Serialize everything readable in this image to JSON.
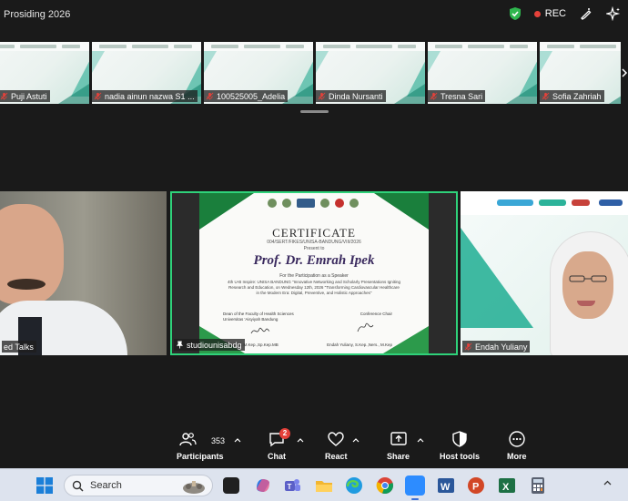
{
  "window": {
    "title": "Prosiding 2026",
    "rec_label": "REC",
    "colors": {
      "rec": "#e5413a",
      "shield": "#2fb64e",
      "active_speaker": "#2fd27a"
    }
  },
  "filmstrip": {
    "tiles": [
      {
        "name": "Puji Astuti"
      },
      {
        "name": "nadia ainun nazwa S1 ..."
      },
      {
        "name": "100525005_Adelia"
      },
      {
        "name": "Dinda Nursanti"
      },
      {
        "name": "Tresna Sari"
      },
      {
        "name": "Sofia Zahriah"
      }
    ]
  },
  "main": {
    "left": {
      "name": "ed Talks"
    },
    "center": {
      "name": "studiounisabdg",
      "certificate": {
        "title": "CERTIFICATE",
        "number": "004/SERT/FIKES/UNISA-BANDUNG/VIII/2026",
        "presented": "Present to",
        "recipient": "Prof. Dr. Emrah Ipek",
        "for_line": "For the Participation as a Speaker",
        "body": "4th U-B Inspire: UNISA BANDUNG \"Innovative Networking and Scholarly Presentations Igniting Research and Education, on Wednesday 12th, 2026 \"Transforming Cardiovascular Healthcare in the Modern Era: Digital, Preventive, and Holistic Approaches\"",
        "sig_left_role": "Dean of the Faculty of Health Sciences",
        "sig_left_org": "Universitas 'Aisyiyah Bandung",
        "sig_right_role": "Conference Chair",
        "sig_left_name": "... Widiarti, M.Kep.,Sp.Kep.MB",
        "sig_right_name": "Endah Yuliany, S.Kep.,Ners., M.Kep"
      }
    },
    "right": {
      "name": "Endah Yuliany"
    }
  },
  "controls": {
    "participants": {
      "label": "Participants",
      "count": "353"
    },
    "chat": {
      "label": "Chat",
      "badge": "2"
    },
    "react": {
      "label": "React"
    },
    "share": {
      "label": "Share"
    },
    "host_tools": {
      "label": "Host tools"
    },
    "more": {
      "label": "More"
    }
  },
  "taskbar": {
    "search_placeholder": "Search",
    "apps": [
      "start-icon",
      "task-view-icon",
      "copilot-icon",
      "teams-icon",
      "file-explorer-icon",
      "edge-icon",
      "chrome-icon",
      "zoom-icon",
      "word-icon",
      "powerpoint-icon",
      "excel-icon",
      "calculator-icon"
    ]
  }
}
